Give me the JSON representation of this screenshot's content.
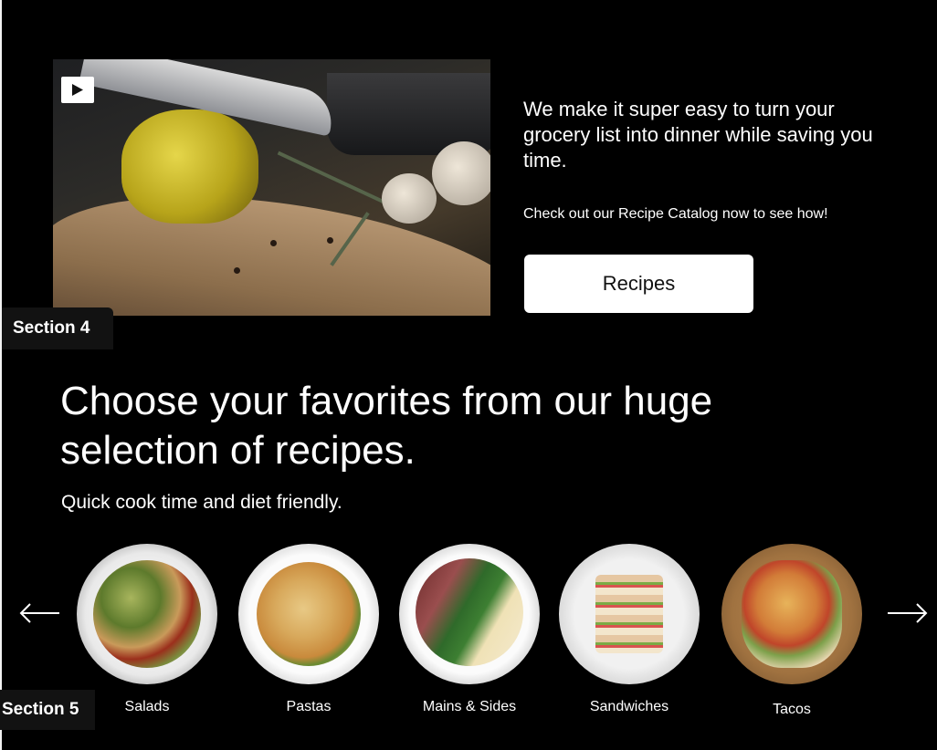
{
  "video": {
    "image_desc": "knife-slicing-yellow-pepper",
    "play_icon": "play-icon"
  },
  "intro": {
    "text": "We make it super easy to turn your grocery list into dinner while saving you time.",
    "note": "Check out our Recipe Catalog now to see how!",
    "button_label": "Recipes"
  },
  "section_labels": {
    "section4": "Section 4",
    "section5": "Section 5"
  },
  "catalog": {
    "headline": "Choose your favorites from our huge selection of recipes.",
    "subhead": "Quick cook time and diet friendly.",
    "prev_icon": "arrow-left-icon",
    "next_icon": "arrow-right-icon",
    "categories": [
      {
        "label": "Salads"
      },
      {
        "label": "Pastas"
      },
      {
        "label": "Mains & Sides"
      },
      {
        "label": "Sandwiches"
      },
      {
        "label": "Tacos"
      }
    ]
  },
  "colors": {
    "background": "#000000",
    "text": "#ffffff",
    "button_bg": "#ffffff",
    "button_text": "#111111",
    "section_tag_bg": "#121212"
  }
}
